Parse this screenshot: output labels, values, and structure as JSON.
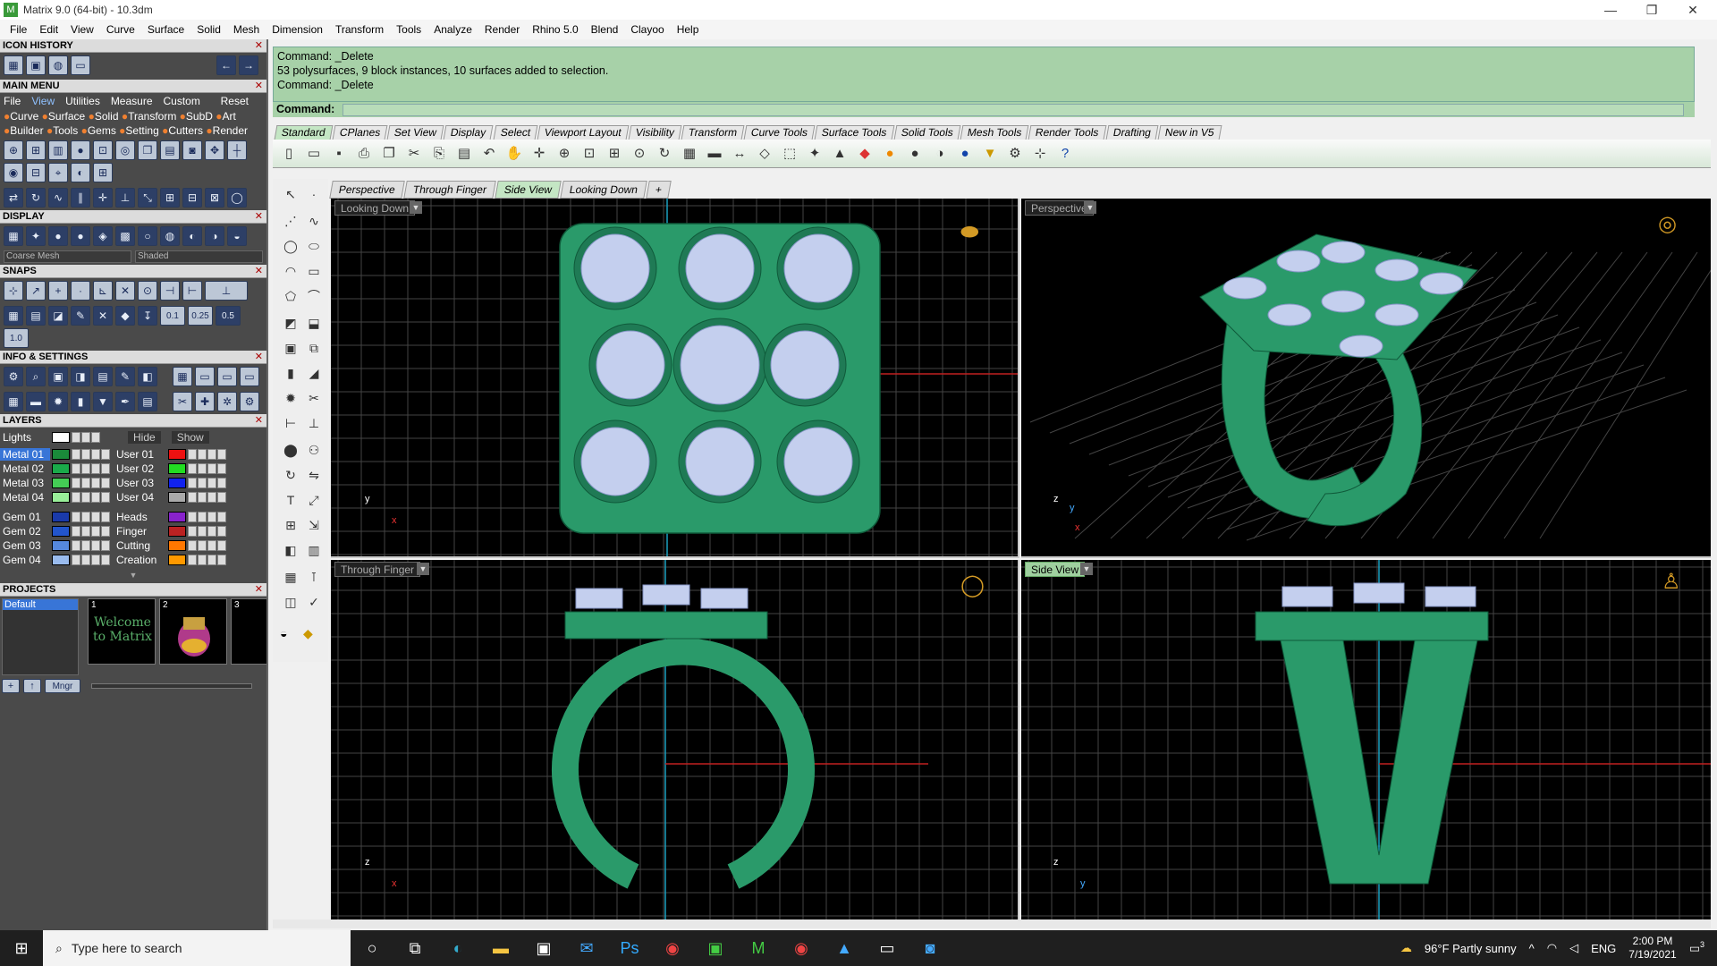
{
  "window": {
    "title": "Matrix 9.0 (64-bit) - 10.3dm",
    "minimize": "—",
    "maximize": "❐",
    "close": "✕"
  },
  "menu": [
    "File",
    "Edit",
    "View",
    "Curve",
    "Surface",
    "Solid",
    "Mesh",
    "Dimension",
    "Transform",
    "Tools",
    "Analyze",
    "Render",
    "Rhino 5.0",
    "Blend",
    "Clayoo",
    "Help"
  ],
  "left_panel": {
    "icon_history": "ICON HISTORY",
    "main_menu": "MAIN MENU",
    "main_menu_tabs": [
      "File",
      "View",
      "Utilities",
      "Measure",
      "Custom",
      "Reset"
    ],
    "main_menu_row1": [
      "Curve",
      "Surface",
      "Solid",
      "Transform",
      "SubD",
      "Art"
    ],
    "main_menu_row2": [
      "Builder",
      "Tools",
      "Gems",
      "Setting",
      "Cutters",
      "Render"
    ],
    "display": "DISPLAY",
    "display_mode_mesh": "Coarse Mesh",
    "display_mode_shade": "Shaded",
    "snaps": "SNAPS",
    "snap_values": [
      "0.1",
      "0.25",
      "0.5",
      "1.0"
    ],
    "info_settings": "INFO & SETTINGS",
    "layers": "LAYERS",
    "lights": "Lights",
    "hide": "Hide",
    "show": "Show",
    "layers_left": [
      {
        "name": "Metal 01",
        "color": "#1a8a3a"
      },
      {
        "name": "Metal 02",
        "color": "#1aaa4a"
      },
      {
        "name": "Metal 03",
        "color": "#44cc55"
      },
      {
        "name": "Metal 04",
        "color": "#99ee99"
      },
      {
        "name": "Gem 01",
        "color": "#1a3aaa"
      },
      {
        "name": "Gem 02",
        "color": "#2255cc"
      },
      {
        "name": "Gem 03",
        "color": "#5588dd"
      },
      {
        "name": "Gem 04",
        "color": "#99bbee"
      }
    ],
    "layers_right": [
      {
        "name": "User 01",
        "color": "#ee1111"
      },
      {
        "name": "User 02",
        "color": "#22dd22"
      },
      {
        "name": "User 03",
        "color": "#1122ee"
      },
      {
        "name": "User 04",
        "color": "#aaaaaa"
      },
      {
        "name": "Heads",
        "color": "#8822cc"
      },
      {
        "name": "Finger",
        "color": "#bb2222"
      },
      {
        "name": "Cutting",
        "color": "#ff7700"
      },
      {
        "name": "Creation",
        "color": "#ff9900"
      }
    ],
    "projects": "PROJECTS",
    "project_default": "Default",
    "project_tiles": [
      "1",
      "2",
      "3"
    ],
    "welcome_text": "Welcome to Matrix",
    "mngr": "Mngr"
  },
  "command": {
    "history": [
      "Command: _Delete",
      "53 polysurfaces, 9 block instances, 10 surfaces added to selection.",
      "Command: _Delete"
    ],
    "prompt": "Command:"
  },
  "toolbar_tabs": [
    "Standard",
    "CPlanes",
    "Set View",
    "Display",
    "Select",
    "Viewport Layout",
    "Visibility",
    "Transform",
    "Curve Tools",
    "Surface Tools",
    "Solid Tools",
    "Mesh Tools",
    "Render Tools",
    "Drafting",
    "New in V5"
  ],
  "viewport_tabs": [
    "Perspective",
    "Through Finger",
    "Side View",
    "Looking Down",
    "+"
  ],
  "viewports": {
    "top_left": "Looking Down",
    "top_right": "Perspective",
    "bottom_left": "Through Finger",
    "bottom_right": "Side View"
  },
  "axes": {
    "x": "x",
    "y": "y",
    "z": "z"
  },
  "colors": {
    "model": "#2a9a6a",
    "gem": "#c4cfee",
    "grid": "#444444",
    "accent_cmd": "#a7d1a8"
  },
  "taskbar": {
    "search_placeholder": "Type here to search",
    "weather": "96°F  Partly sunny",
    "lang": "ENG",
    "time": "2:00 PM",
    "date": "7/19/2021",
    "notif": "3"
  }
}
